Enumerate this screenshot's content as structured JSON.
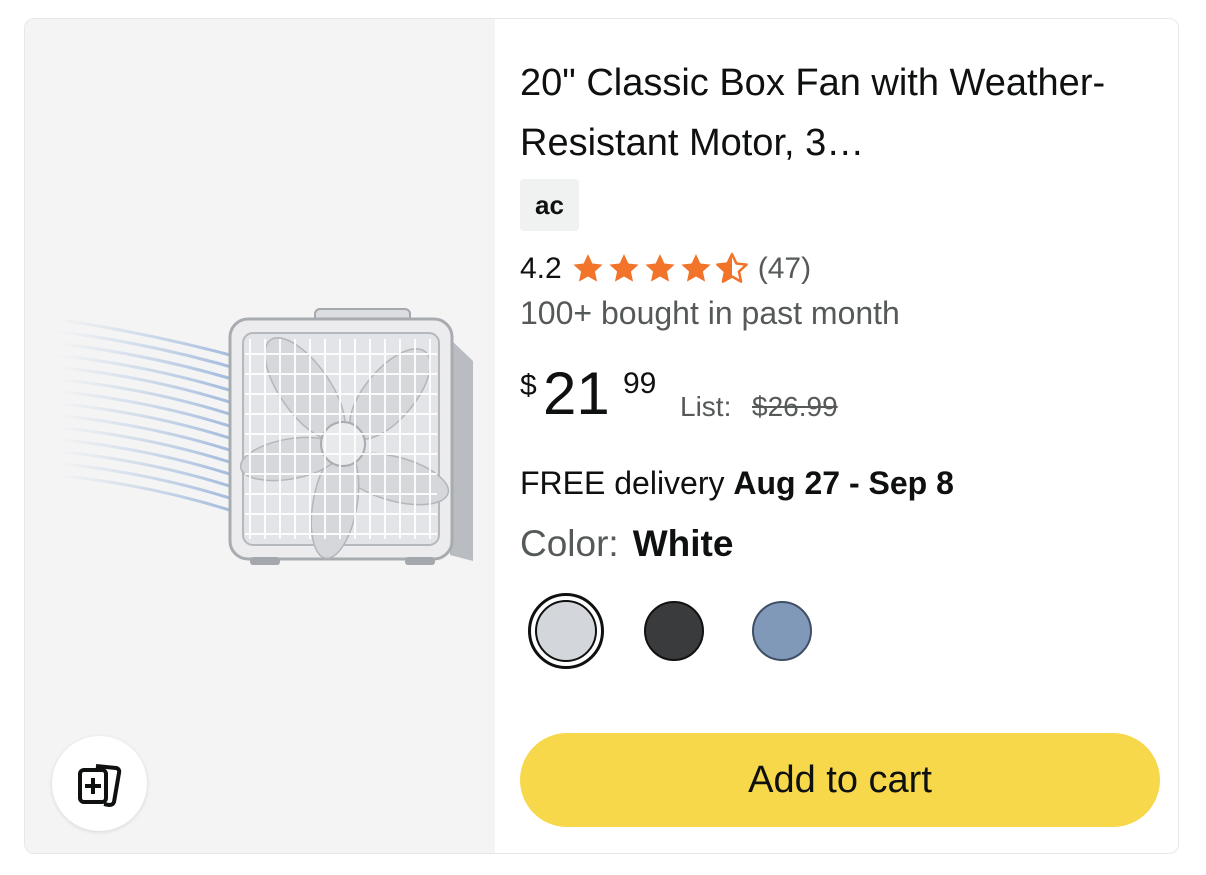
{
  "product": {
    "title": "20\" Classic Box Fan with Weather-Resistant Motor, 3…",
    "brand_badge": "ac",
    "rating": "4.2",
    "rating_value": 4.2,
    "review_count": "(47)",
    "bought": "100+ bought in past month",
    "price": {
      "symbol": "$",
      "whole": "21",
      "fraction": "99",
      "list_label": "List:",
      "list_price": "$26.99"
    },
    "delivery": {
      "prefix": "FREE delivery",
      "dates": "Aug 27 - Sep 8"
    },
    "color": {
      "label": "Color:",
      "value": "White",
      "swatches": [
        {
          "name": "white",
          "hex": "#d3d6da",
          "selected": true
        },
        {
          "name": "black",
          "hex": "#3a3b3d",
          "selected": false
        },
        {
          "name": "blue",
          "hex": "#8199b8",
          "selected": false
        }
      ]
    },
    "add_to_cart": "Add to cart"
  },
  "colors": {
    "star": "#f1742a",
    "cart_button": "#f7d84a",
    "media_bg": "#f4f4f4"
  },
  "icons": {
    "compare": "compare-icon",
    "star": "star-icon"
  }
}
